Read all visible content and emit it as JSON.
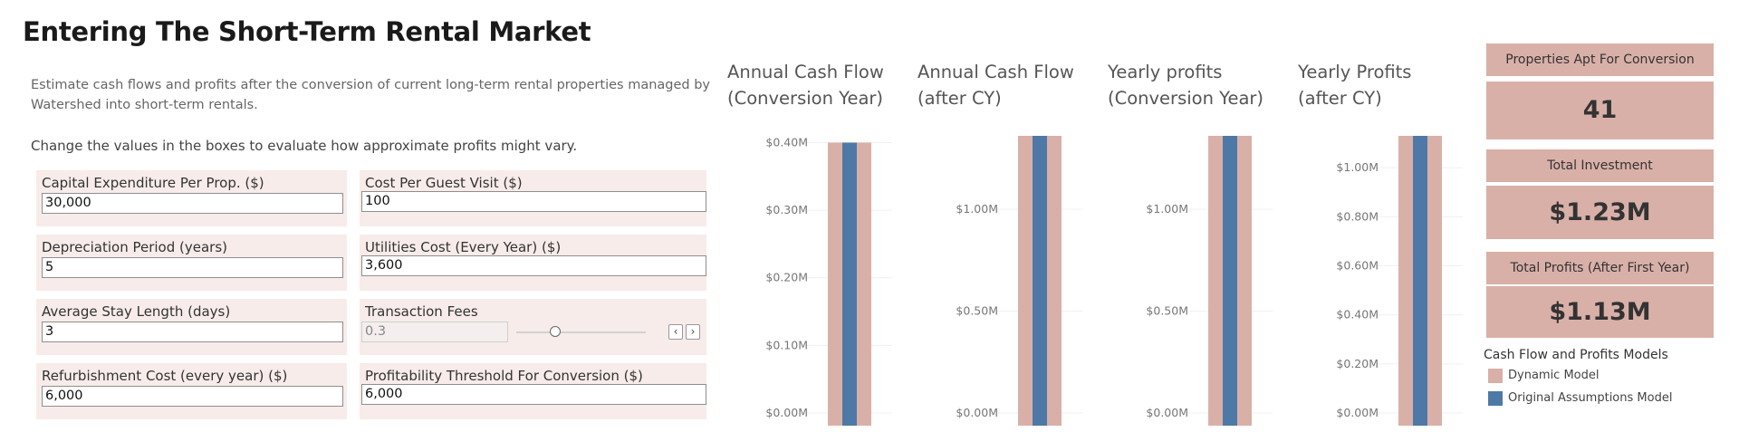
{
  "title": "Entering The Short-Term Rental Market",
  "description": "Estimate cash flows and profits after the conversion of current long-term rental properties managed by Watershed into short-term rentals.",
  "instructions": "Change the values in the boxes to evaluate how approximate profits might vary.",
  "parameters": {
    "capex": {
      "label": "Capital Expenditure Per Prop. ($)",
      "value": "30,000"
    },
    "cost_per_visit": {
      "label": "Cost Per Guest Visit ($)",
      "value": "100"
    },
    "depreciation": {
      "label": "Depreciation Period (years)",
      "value": "5"
    },
    "utilities": {
      "label": "Utilities Cost (Every Year) ($)",
      "value": "3,600"
    },
    "stay_length": {
      "label": "Average Stay Length (days)",
      "value": "3"
    },
    "transaction_fees": {
      "label": "Transaction Fees",
      "value": "0.3",
      "slider_fraction": 0.3
    },
    "refurbishment": {
      "label": "Refurbishment Cost (every year) ($)",
      "value": "6,000"
    },
    "threshold": {
      "label": "Profitability Threshold For Conversion ($)",
      "value": "6,000"
    }
  },
  "chart_data": [
    {
      "type": "bar",
      "title": "Annual Cash Flow\n(Conversion Year)",
      "title_lines": [
        "Annual Cash Flow",
        "(Conversion Year)"
      ],
      "ticks": [
        {
          "v": 0.0,
          "label": "$0.00M"
        },
        {
          "v": 0.1,
          "label": "$0.10M"
        },
        {
          "v": 0.2,
          "label": "$0.20M"
        },
        {
          "v": 0.3,
          "label": "$0.30M"
        },
        {
          "v": 0.4,
          "label": "$0.40M"
        }
      ],
      "ylim": [
        0,
        0.41
      ],
      "series": [
        {
          "name": "Dynamic Model",
          "values": [
            0.4
          ]
        },
        {
          "name": "Original Assumptions Model",
          "values": [
            0.4
          ]
        }
      ]
    },
    {
      "type": "bar",
      "title": "Annual Cash Flow\n(after CY)",
      "title_lines": [
        "Annual Cash Flow",
        "(after CY)"
      ],
      "ticks": [
        {
          "v": 0.0,
          "label": "$0.00M"
        },
        {
          "v": 0.5,
          "label": "$0.50M"
        },
        {
          "v": 1.0,
          "label": "$1.00M"
        }
      ],
      "ylim": [
        0,
        1.36
      ],
      "series": [
        {
          "name": "Dynamic Model",
          "values": [
            1.36
          ]
        },
        {
          "name": "Original Assumptions Model",
          "values": [
            1.36
          ]
        }
      ]
    },
    {
      "type": "bar",
      "title": "Yearly profits\n(Conversion Year)",
      "title_lines": [
        "Yearly profits",
        "(Conversion Year)"
      ],
      "ticks": [
        {
          "v": 0.0,
          "label": "$0.00M"
        },
        {
          "v": 0.5,
          "label": "$0.50M"
        },
        {
          "v": 1.0,
          "label": "$1.00M"
        }
      ],
      "ylim": [
        0,
        1.36
      ],
      "series": [
        {
          "name": "Dynamic Model",
          "values": [
            1.36
          ]
        },
        {
          "name": "Original Assumptions Model",
          "values": [
            1.36
          ]
        }
      ]
    },
    {
      "type": "bar",
      "title": "Yearly Profits\n(after CY)",
      "title_lines": [
        "Yearly Profits",
        "(after CY)"
      ],
      "ticks": [
        {
          "v": 0.0,
          "label": "$0.00M"
        },
        {
          "v": 0.2,
          "label": "$0.20M"
        },
        {
          "v": 0.4,
          "label": "$0.40M"
        },
        {
          "v": 0.6,
          "label": "$0.60M"
        },
        {
          "v": 0.8,
          "label": "$0.80M"
        },
        {
          "v": 1.0,
          "label": "$1.00M"
        }
      ],
      "ylim": [
        0,
        1.13
      ],
      "series": [
        {
          "name": "Dynamic Model",
          "values": [
            1.13
          ]
        },
        {
          "name": "Original Assumptions Model",
          "values": [
            1.13
          ]
        }
      ]
    }
  ],
  "kpis": [
    {
      "label": "Properties Apt For Conversion",
      "value": "41"
    },
    {
      "label": "Total Investment",
      "value": "$1.23M"
    },
    {
      "label": "Total Profits (After First Year)",
      "value": "$1.13M"
    }
  ],
  "legend": {
    "title": "Cash Flow and Profits Models",
    "items": [
      {
        "label": "Dynamic Model",
        "color": "#d9b0a8"
      },
      {
        "label": "Original Assumptions Model",
        "color": "#4e79a7"
      }
    ]
  },
  "colors": {
    "dynamic": "#d9b0a8",
    "original": "#4e79a7",
    "param_bg": "#f7ece9"
  }
}
